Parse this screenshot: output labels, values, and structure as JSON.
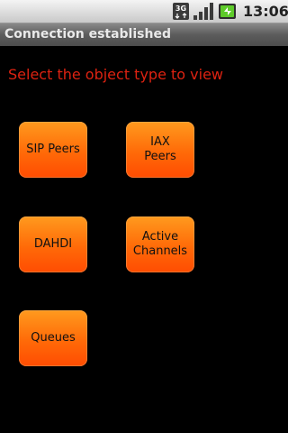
{
  "status_bar": {
    "network_type": "3G",
    "time": "13:06",
    "icons": [
      "3g-data-icon",
      "signal-strength-icon",
      "battery-charging-icon"
    ]
  },
  "title_bar": {
    "title": "Connection established"
  },
  "main": {
    "prompt": "Select the object type to view",
    "buttons": [
      {
        "label": "SIP Peers"
      },
      {
        "label": "IAX Peers"
      },
      {
        "label": "DAHDI"
      },
      {
        "label": "Active Channels"
      },
      {
        "label": "Queues"
      }
    ]
  },
  "colors": {
    "background": "#000000",
    "prompt_text": "#dd2211",
    "button_orange": "#ff6a08",
    "title_bar": "#5c5c5c",
    "status_bar": "#dcdcdc"
  }
}
